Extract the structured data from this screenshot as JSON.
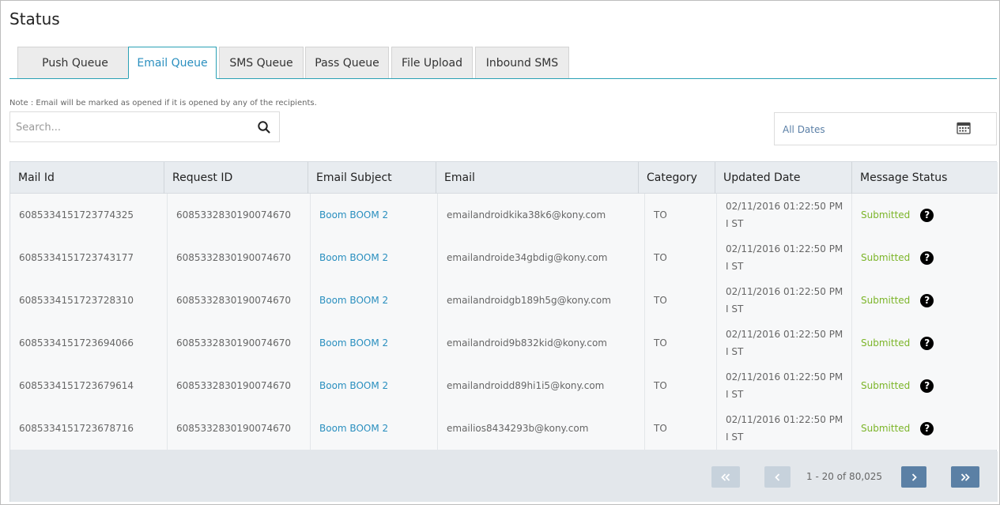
{
  "page": {
    "title": "Status"
  },
  "tabs": [
    {
      "label": "Push Queue"
    },
    {
      "label": "Email Queue"
    },
    {
      "label": "SMS Queue"
    },
    {
      "label": "Pass Queue"
    },
    {
      "label": "File Upload"
    },
    {
      "label": "Inbound SMS"
    }
  ],
  "active_tab": "Email Queue",
  "note": "Note : Email will be marked as opened if it is opened by any of the recipients.",
  "search": {
    "placeholder": "Search...",
    "value": "",
    "icon": "search-icon"
  },
  "date_filter": {
    "label": "All Dates",
    "icon": "calendar-icon"
  },
  "table": {
    "columns": [
      "Mail Id",
      "Request ID",
      "Email Subject",
      "Email",
      "Category",
      "Updated Date",
      "Message Status"
    ],
    "rows": [
      {
        "mail_id": "6085334151723774325",
        "request_id": "6085332830190074670",
        "subject": "Boom BOOM 2",
        "email": "emailandroidkika38k6@kony.com",
        "category": "TO",
        "updated": "02/11/2016 01:22:50 PM I ST",
        "status": "Submitted"
      },
      {
        "mail_id": "6085334151723743177",
        "request_id": "6085332830190074670",
        "subject": "Boom BOOM 2",
        "email": "emailandroide34gbdig@kony.com",
        "category": "TO",
        "updated": "02/11/2016 01:22:50 PM I ST",
        "status": "Submitted"
      },
      {
        "mail_id": "6085334151723728310",
        "request_id": "6085332830190074670",
        "subject": "Boom BOOM 2",
        "email": "emailandroidgb189h5g@kony.com",
        "category": "TO",
        "updated": "02/11/2016 01:22:50 PM I ST",
        "status": "Submitted"
      },
      {
        "mail_id": "6085334151723694066",
        "request_id": "6085332830190074670",
        "subject": "Boom BOOM 2",
        "email": "emailandroid9b832kid@kony.com",
        "category": "TO",
        "updated": "02/11/2016 01:22:50 PM I ST",
        "status": "Submitted"
      },
      {
        "mail_id": "6085334151723679614",
        "request_id": "6085332830190074670",
        "subject": "Boom BOOM 2",
        "email": "emailandroidd89hi1i5@kony.com",
        "category": "TO",
        "updated": "02/11/2016 01:22:50 PM I ST",
        "status": "Submitted"
      },
      {
        "mail_id": "6085334151723678716",
        "request_id": "6085332830190074670",
        "subject": "Boom BOOM 2",
        "email": "emailios8434293b@kony.com",
        "category": "TO",
        "updated": "02/11/2016 01:22:50 PM I ST",
        "status": "Submitted"
      }
    ]
  },
  "pagination": {
    "info": "1 - 20 of 80,025",
    "first_icon": "double-chevron-left-icon",
    "prev_icon": "chevron-left-icon",
    "next_icon": "chevron-right-icon",
    "last_icon": "double-chevron-right-icon"
  },
  "colors": {
    "accent": "#2aa1b5",
    "link": "#2a8fbf",
    "status_submitted": "#7cb529",
    "pager_enabled": "#5b80a5",
    "pager_disabled": "#c7d2dc"
  }
}
